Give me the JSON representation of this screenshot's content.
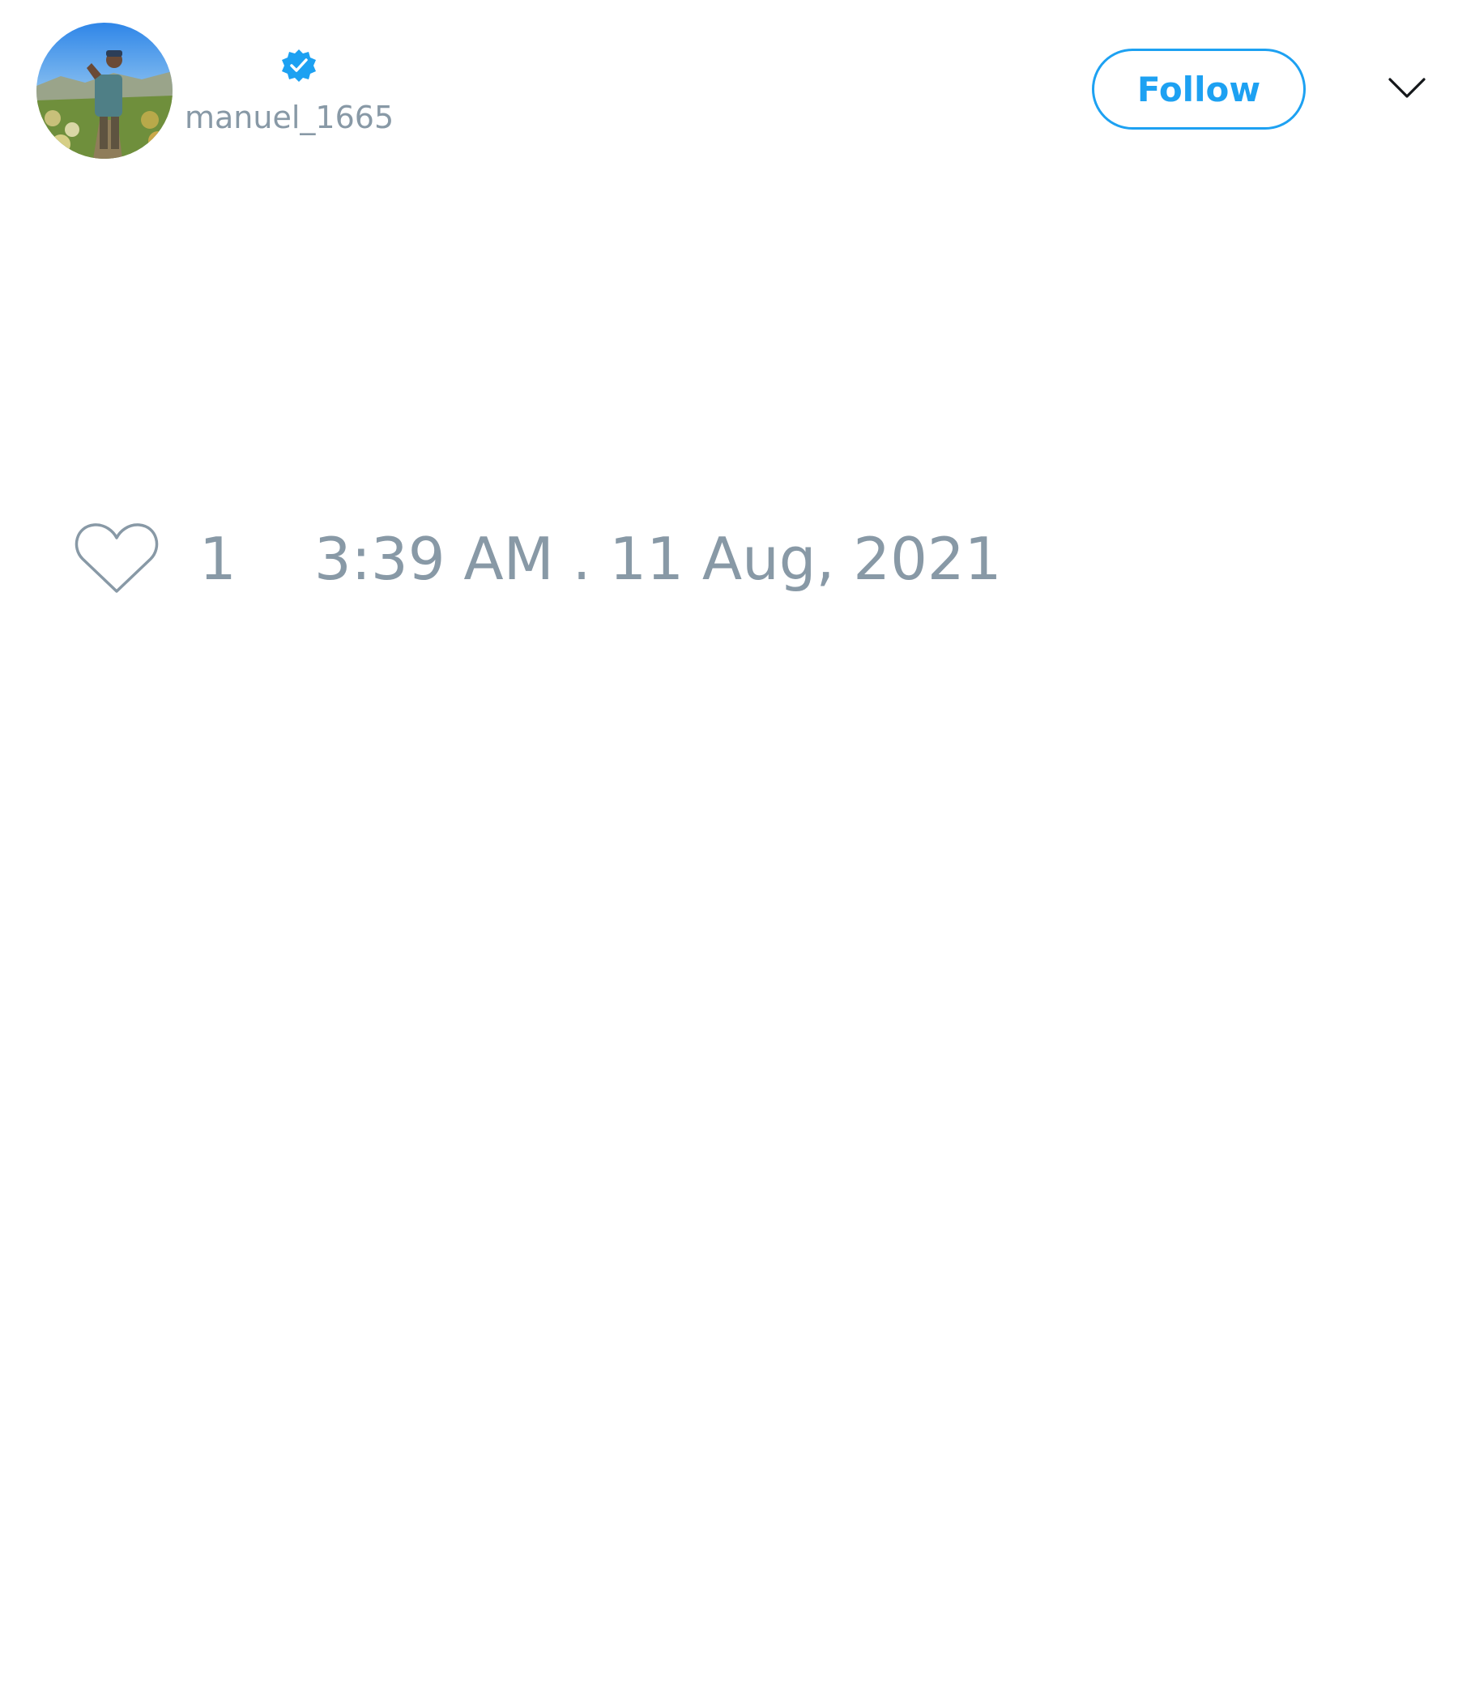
{
  "tweet": {
    "author": {
      "display_name": "",
      "handle": "manuel_1665",
      "verified": true,
      "avatar": "profile-photo"
    },
    "follow_label": "Follow",
    "menu_icon": "chevron-down-icon",
    "text": "",
    "like_icon": "heart-outline-icon",
    "like_count": "1",
    "timestamp": "3:39 AM . 11 Aug, 2021"
  },
  "colors": {
    "accent": "#1da1f2",
    "muted_text": "#8899a6",
    "badge": "#1da1f2",
    "background": "#ffffff"
  }
}
